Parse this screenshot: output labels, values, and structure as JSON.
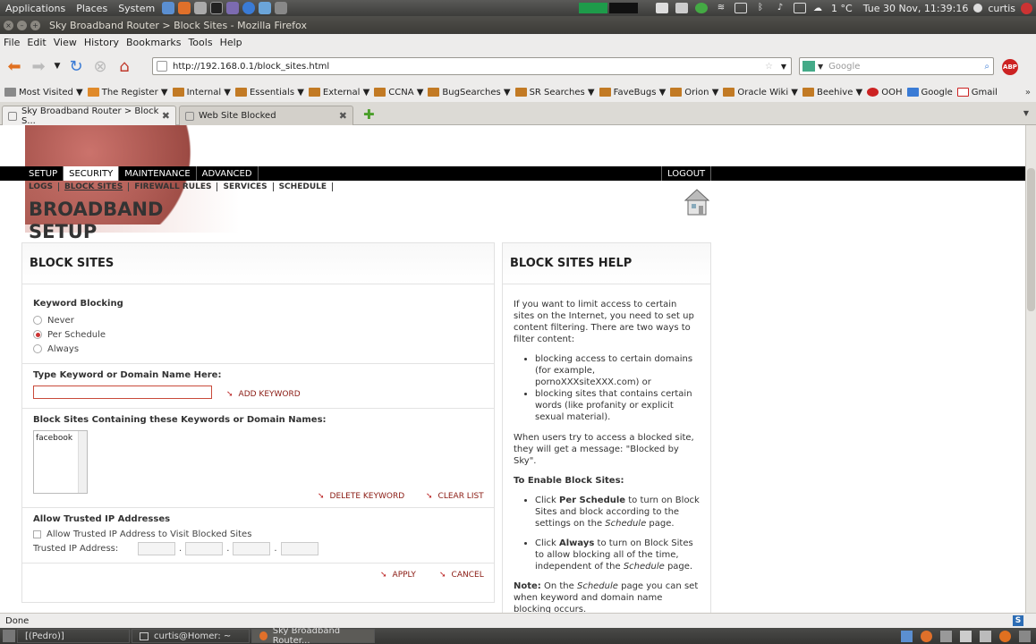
{
  "top_panel": {
    "applications": "Applications",
    "places": "Places",
    "system": "System",
    "weather": "1 °C",
    "clock": "Tue 30 Nov, 11:39:16",
    "user": "curtis"
  },
  "window": {
    "title": "Sky Broadband Router > Block Sites - Mozilla Firefox"
  },
  "menubar": [
    "File",
    "Edit",
    "View",
    "History",
    "Bookmarks",
    "Tools",
    "Help"
  ],
  "nav": {
    "url": "http://192.168.0.1/block_sites.html",
    "search_placeholder": "Google"
  },
  "bookmarks": [
    "Most Visited ▼",
    "The Register ▼",
    "Internal ▼",
    "Essentials ▼",
    "External ▼",
    "CCNA ▼",
    "BugSearches ▼",
    "SR Searches ▼",
    "FaveBugs ▼",
    "Orion ▼",
    "Oracle Wiki ▼",
    "Beehive ▼",
    "OOH",
    "Google",
    "Gmail"
  ],
  "tabs": [
    {
      "label": "Sky Broadband Router > Block S..."
    },
    {
      "label": "Web Site Blocked"
    }
  ],
  "router": {
    "main_tabs": [
      "SETUP",
      "SECURITY",
      "MAINTENANCE",
      "ADVANCED"
    ],
    "logout": "LOGOUT",
    "sub_tabs": [
      "LOGS",
      "BLOCK SITES",
      "FIREWALL RULES",
      "SERVICES",
      "SCHEDULE"
    ],
    "title_line1": "BROADBAND",
    "title_line2": "SETUP"
  },
  "block": {
    "heading": "BLOCK SITES",
    "keyword_blocking": "Keyword Blocking",
    "options": [
      "Never",
      "Per Schedule",
      "Always"
    ],
    "selected": "Per Schedule",
    "type_label": "Type Keyword or Domain Name Here:",
    "keyword_value": "",
    "add_keyword": "ADD KEYWORD",
    "list_label": "Block Sites Containing these Keywords or Domain Names:",
    "list_items": [
      "facebook"
    ],
    "delete_keyword": "DELETE KEYWORD",
    "clear_list": "CLEAR LIST",
    "trusted_title": "Allow Trusted IP Addresses",
    "trusted_checkbox": "Allow Trusted IP Address to Visit Blocked Sites",
    "trusted_ip_label": "Trusted IP Address:",
    "apply": "APPLY",
    "cancel": "CANCEL"
  },
  "help": {
    "heading": "BLOCK SITES HELP",
    "intro": "If you want to limit access to certain sites on the Internet, you need to set up content filtering. There are two ways to filter content:",
    "bullet1": "blocking access to certain domains (for example, pornoXXXsiteXXX.com) or",
    "bullet2": "blocking sites that contains certain words (like profanity or explicit sexual material).",
    "para2": "When users try to access a blocked site, they will get a message: \"Blocked by Sky\".",
    "enable_title": "To Enable Block Sites:",
    "enable1_a": "Click ",
    "enable1_b": "Per Schedule",
    "enable1_c": " to turn on Block Sites and block according to the settings on the ",
    "enable1_d": "Schedule",
    "enable1_e": " page.",
    "enable2_a": "Click ",
    "enable2_b": "Always",
    "enable2_c": " to turn on Block Sites to allow blocking all of the time, independent of the ",
    "enable2_d": "Schedule",
    "enable2_e": " page.",
    "note_a": "Note:",
    "note_b": " On the ",
    "note_c": "Schedule",
    "note_d": " page you can set when keyword and domain name blocking occurs."
  },
  "status": {
    "text": "Done"
  },
  "taskbar": [
    "[(Pedro)]",
    "curtis@Homer: ~",
    "Sky Broadband Router..."
  ]
}
